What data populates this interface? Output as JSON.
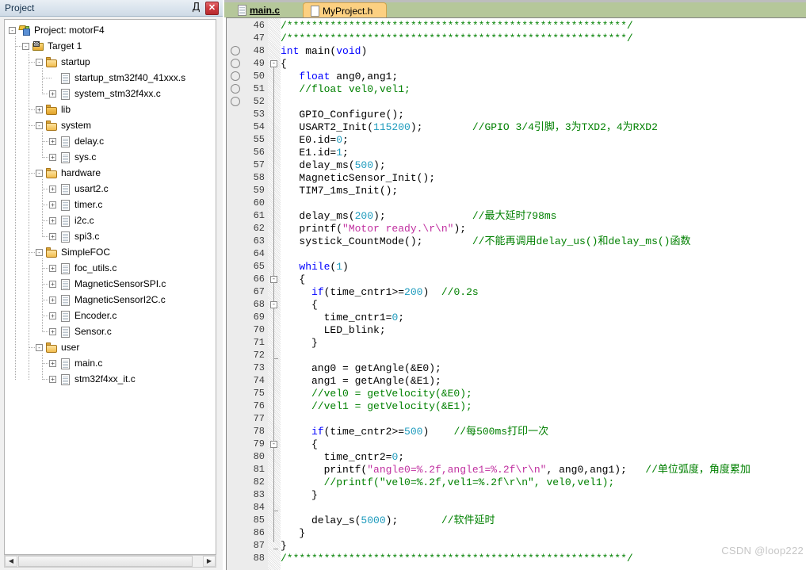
{
  "project_panel": {
    "title": "Project",
    "pin_icon": "pin-icon",
    "close_icon": "close-icon",
    "pin_glyph": "Д",
    "close_glyph": "✕",
    "scroll_left_glyph": "◀",
    "scroll_right_glyph": "▶",
    "tree": [
      {
        "label": "Project: motorF4",
        "depth": 0,
        "icon": "project-icon",
        "expander": "-"
      },
      {
        "label": "Target 1",
        "depth": 1,
        "icon": "target-icon",
        "expander": "-"
      },
      {
        "label": "startup",
        "depth": 2,
        "icon": "folder-open-icon",
        "expander": "-"
      },
      {
        "label": "startup_stm32f40_41xxx.s",
        "depth": 3,
        "icon": "file-icon",
        "expander": ""
      },
      {
        "label": "system_stm32f4xx.c",
        "depth": 3,
        "icon": "file-icon",
        "expander": "+"
      },
      {
        "label": "lib",
        "depth": 2,
        "icon": "folder-closed-icon",
        "expander": "+"
      },
      {
        "label": "system",
        "depth": 2,
        "icon": "folder-open-icon",
        "expander": "-"
      },
      {
        "label": "delay.c",
        "depth": 3,
        "icon": "file-icon",
        "expander": "+"
      },
      {
        "label": "sys.c",
        "depth": 3,
        "icon": "file-icon",
        "expander": "+"
      },
      {
        "label": "hardware",
        "depth": 2,
        "icon": "folder-open-icon",
        "expander": "-"
      },
      {
        "label": "usart2.c",
        "depth": 3,
        "icon": "file-icon",
        "expander": "+"
      },
      {
        "label": "timer.c",
        "depth": 3,
        "icon": "file-icon",
        "expander": "+"
      },
      {
        "label": "i2c.c",
        "depth": 3,
        "icon": "file-icon",
        "expander": "+"
      },
      {
        "label": "spi3.c",
        "depth": 3,
        "icon": "file-icon",
        "expander": "+"
      },
      {
        "label": "SimpleFOC",
        "depth": 2,
        "icon": "folder-open-icon",
        "expander": "-"
      },
      {
        "label": "foc_utils.c",
        "depth": 3,
        "icon": "file-icon",
        "expander": "+"
      },
      {
        "label": "MagneticSensorSPI.c",
        "depth": 3,
        "icon": "file-icon",
        "expander": "+"
      },
      {
        "label": "MagneticSensorI2C.c",
        "depth": 3,
        "icon": "file-icon",
        "expander": "+"
      },
      {
        "label": "Encoder.c",
        "depth": 3,
        "icon": "file-icon",
        "expander": "+"
      },
      {
        "label": "Sensor.c",
        "depth": 3,
        "icon": "file-icon",
        "expander": "+"
      },
      {
        "label": "user",
        "depth": 2,
        "icon": "folder-open-icon",
        "expander": "-"
      },
      {
        "label": "main.c",
        "depth": 3,
        "icon": "file-icon",
        "expander": "+"
      },
      {
        "label": "stm32f4xx_it.c",
        "depth": 3,
        "icon": "file-icon",
        "expander": "+"
      }
    ]
  },
  "editor": {
    "tabs": [
      {
        "label": "main.c",
        "active": true,
        "icon": "c-file-icon"
      },
      {
        "label": "MyProject.h",
        "active": false,
        "icon": "h-file-icon"
      }
    ],
    "first_line": 46,
    "last_line": 88,
    "breakpoint_lines": [
      48,
      49,
      50,
      51,
      52
    ],
    "watermark": "CSDN @loop222",
    "lines": [
      {
        "n": 46,
        "tokens": [
          {
            "t": "/*******************************************************/",
            "c": "cmt"
          }
        ]
      },
      {
        "n": 47,
        "tokens": [
          {
            "t": "/*******************************************************/",
            "c": "cmt"
          }
        ]
      },
      {
        "n": 48,
        "tokens": [
          {
            "t": "int",
            "c": "kw"
          },
          {
            "t": " main(",
            "c": ""
          },
          {
            "t": "void",
            "c": "kw"
          },
          {
            "t": ")",
            "c": ""
          }
        ]
      },
      {
        "n": 49,
        "tokens": [
          {
            "t": "{",
            "c": ""
          }
        ]
      },
      {
        "n": 50,
        "tokens": [
          {
            "t": "   ",
            "c": ""
          },
          {
            "t": "float",
            "c": "kw"
          },
          {
            "t": " ang0,ang1;",
            "c": ""
          }
        ]
      },
      {
        "n": 51,
        "tokens": [
          {
            "t": "   //float vel0,vel1;",
            "c": "cmt"
          }
        ]
      },
      {
        "n": 52,
        "tokens": []
      },
      {
        "n": 53,
        "tokens": [
          {
            "t": "   GPIO_Configure();",
            "c": ""
          }
        ]
      },
      {
        "n": 54,
        "tokens": [
          {
            "t": "   USART2_Init(",
            "c": ""
          },
          {
            "t": "115200",
            "c": "num"
          },
          {
            "t": ");",
            "c": ""
          },
          {
            "t": "        //GPIO 3/4引脚，3为TXD2，4为RXD2",
            "c": "cmt"
          }
        ]
      },
      {
        "n": 55,
        "tokens": [
          {
            "t": "   E0.id=",
            "c": ""
          },
          {
            "t": "0",
            "c": "num"
          },
          {
            "t": ";",
            "c": ""
          }
        ]
      },
      {
        "n": 56,
        "tokens": [
          {
            "t": "   E1.id=",
            "c": ""
          },
          {
            "t": "1",
            "c": "num"
          },
          {
            "t": ";",
            "c": ""
          }
        ]
      },
      {
        "n": 57,
        "tokens": [
          {
            "t": "   delay_ms(",
            "c": ""
          },
          {
            "t": "500",
            "c": "num"
          },
          {
            "t": ");",
            "c": ""
          }
        ]
      },
      {
        "n": 58,
        "tokens": [
          {
            "t": "   MagneticSensor_Init();",
            "c": ""
          }
        ]
      },
      {
        "n": 59,
        "tokens": [
          {
            "t": "   TIM7_1ms_Init();",
            "c": ""
          }
        ]
      },
      {
        "n": 60,
        "tokens": []
      },
      {
        "n": 61,
        "tokens": [
          {
            "t": "   delay_ms(",
            "c": ""
          },
          {
            "t": "200",
            "c": "num"
          },
          {
            "t": ");",
            "c": ""
          },
          {
            "t": "              //最大延时798ms",
            "c": "cmt"
          }
        ]
      },
      {
        "n": 62,
        "tokens": [
          {
            "t": "   printf(",
            "c": ""
          },
          {
            "t": "\"Motor ready.\\r\\n\"",
            "c": "str"
          },
          {
            "t": ");",
            "c": ""
          }
        ]
      },
      {
        "n": 63,
        "tokens": [
          {
            "t": "   systick_CountMode();",
            "c": ""
          },
          {
            "t": "        //不能再调用delay_us()和delay_ms()函数",
            "c": "cmt"
          }
        ]
      },
      {
        "n": 64,
        "tokens": []
      },
      {
        "n": 65,
        "tokens": [
          {
            "t": "   ",
            "c": ""
          },
          {
            "t": "while",
            "c": "kw"
          },
          {
            "t": "(",
            "c": ""
          },
          {
            "t": "1",
            "c": "num"
          },
          {
            "t": ")",
            "c": ""
          }
        ]
      },
      {
        "n": 66,
        "tokens": [
          {
            "t": "   {",
            "c": ""
          }
        ]
      },
      {
        "n": 67,
        "tokens": [
          {
            "t": "     ",
            "c": ""
          },
          {
            "t": "if",
            "c": "kw"
          },
          {
            "t": "(time_cntr1>=",
            "c": ""
          },
          {
            "t": "200",
            "c": "num"
          },
          {
            "t": ")",
            "c": ""
          },
          {
            "t": "  //0.2s",
            "c": "cmt"
          }
        ]
      },
      {
        "n": 68,
        "tokens": [
          {
            "t": "     {",
            "c": ""
          }
        ]
      },
      {
        "n": 69,
        "tokens": [
          {
            "t": "       time_cntr1=",
            "c": ""
          },
          {
            "t": "0",
            "c": "num"
          },
          {
            "t": ";",
            "c": ""
          }
        ]
      },
      {
        "n": 70,
        "tokens": [
          {
            "t": "       LED_blink;",
            "c": ""
          }
        ]
      },
      {
        "n": 71,
        "tokens": [
          {
            "t": "     }",
            "c": ""
          }
        ]
      },
      {
        "n": 72,
        "tokens": []
      },
      {
        "n": 73,
        "tokens": [
          {
            "t": "     ang0 = getAngle(&E0);",
            "c": ""
          }
        ]
      },
      {
        "n": 74,
        "tokens": [
          {
            "t": "     ang1 = getAngle(&E1);",
            "c": ""
          }
        ]
      },
      {
        "n": 75,
        "tokens": [
          {
            "t": "     //vel0 = getVelocity(&E0);",
            "c": "cmt"
          }
        ]
      },
      {
        "n": 76,
        "tokens": [
          {
            "t": "     //vel1 = getVelocity(&E1);",
            "c": "cmt"
          }
        ]
      },
      {
        "n": 77,
        "tokens": []
      },
      {
        "n": 78,
        "tokens": [
          {
            "t": "     ",
            "c": ""
          },
          {
            "t": "if",
            "c": "kw"
          },
          {
            "t": "(time_cntr2>=",
            "c": ""
          },
          {
            "t": "500",
            "c": "num"
          },
          {
            "t": ")",
            "c": ""
          },
          {
            "t": "    //每500ms打印一次",
            "c": "cmt"
          }
        ]
      },
      {
        "n": 79,
        "tokens": [
          {
            "t": "     {",
            "c": ""
          }
        ]
      },
      {
        "n": 80,
        "tokens": [
          {
            "t": "       time_cntr2=",
            "c": ""
          },
          {
            "t": "0",
            "c": "num"
          },
          {
            "t": ";",
            "c": ""
          }
        ]
      },
      {
        "n": 81,
        "tokens": [
          {
            "t": "       printf(",
            "c": ""
          },
          {
            "t": "\"angle0=%.2f,angle1=%.2f\\r\\n\"",
            "c": "str"
          },
          {
            "t": ", ang0,ang1);",
            "c": ""
          },
          {
            "t": "   //单位弧度，角度累加",
            "c": "cmt"
          }
        ]
      },
      {
        "n": 82,
        "tokens": [
          {
            "t": "       //printf(\"vel0=%.2f,vel1=%.2f\\r\\n\", vel0,vel1);",
            "c": "cmt"
          }
        ]
      },
      {
        "n": 83,
        "tokens": [
          {
            "t": "     }",
            "c": ""
          }
        ]
      },
      {
        "n": 84,
        "tokens": []
      },
      {
        "n": 85,
        "tokens": [
          {
            "t": "     delay_s(",
            "c": ""
          },
          {
            "t": "5000",
            "c": "num"
          },
          {
            "t": ");",
            "c": ""
          },
          {
            "t": "       //软件延时",
            "c": "cmt"
          }
        ]
      },
      {
        "n": 86,
        "tokens": [
          {
            "t": "   }",
            "c": ""
          }
        ]
      },
      {
        "n": 87,
        "tokens": [
          {
            "t": "}",
            "c": ""
          }
        ]
      },
      {
        "n": 88,
        "tokens": [
          {
            "t": "/*******************************************************/",
            "c": "cmt"
          }
        ]
      }
    ],
    "fold_markers": [
      {
        "line": 49,
        "glyph": "-"
      },
      {
        "line": 66,
        "glyph": "-"
      },
      {
        "line": 68,
        "glyph": "-"
      },
      {
        "line": 79,
        "glyph": "-"
      }
    ]
  }
}
